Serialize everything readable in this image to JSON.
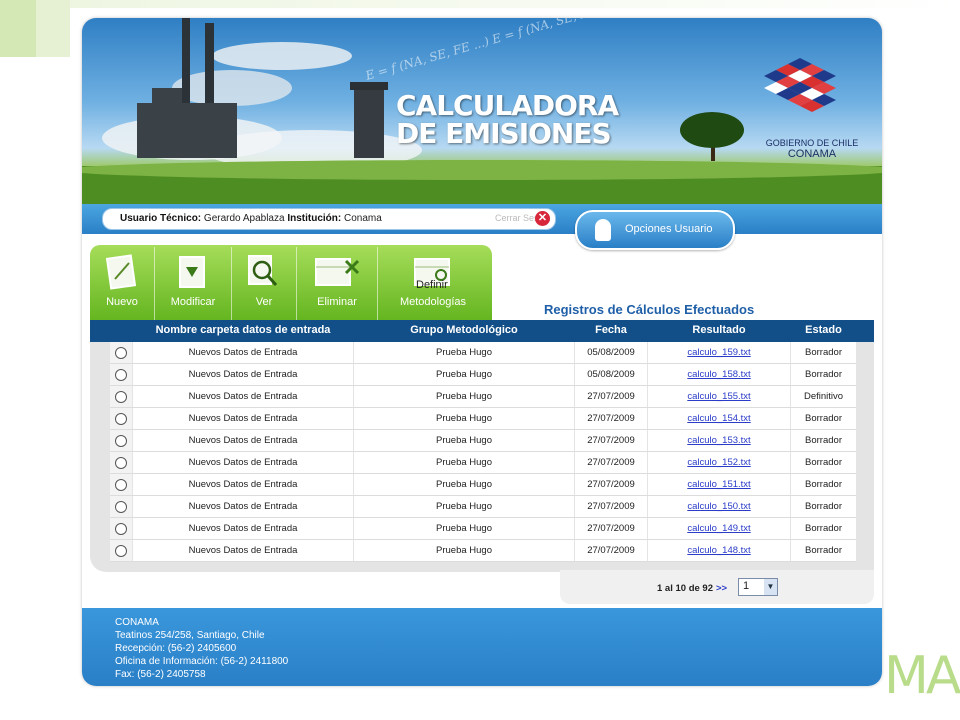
{
  "banner": {
    "title_line1": "CALCULADORA",
    "title_line2": "DE EMISIONES",
    "formula": "E = f (NA, SE, FE ...) E = f (NA, SE, FE ...)",
    "gov_line1": "GOBIERNO DE CHILE",
    "gov_line2": "CONAMA"
  },
  "userbar": {
    "user_label": "Usuario Técnico:",
    "user_value": "Gerardo Apablaza",
    "institution_label": "Institución:",
    "institution_value": "Conama",
    "logout_label": "Cerrar Sesión",
    "options_label": "Opciones Usuario"
  },
  "toolbar": {
    "items": [
      {
        "label": "Nuevo"
      },
      {
        "label": "Modificar"
      },
      {
        "label": "Ver"
      },
      {
        "label": "Eliminar"
      },
      {
        "label": "Metodologías"
      }
    ],
    "overlay_text": "Definir"
  },
  "records": {
    "title": "Registros de Cálculos Efectuados",
    "columns": [
      "Nombre carpeta datos de entrada",
      "Grupo Metodológico",
      "Fecha",
      "Resultado",
      "Estado"
    ],
    "rows": [
      {
        "name": "Nuevos Datos de Entrada",
        "group": "Prueba Hugo",
        "date": "05/08/2009",
        "result": "calculo_159.txt",
        "status": "Borrador"
      },
      {
        "name": "Nuevos Datos de Entrada",
        "group": "Prueba Hugo",
        "date": "05/08/2009",
        "result": "calculo_158.txt",
        "status": "Borrador"
      },
      {
        "name": "Nuevos Datos de Entrada",
        "group": "Prueba Hugo",
        "date": "27/07/2009",
        "result": "calculo_155.txt",
        "status": "Definitivo"
      },
      {
        "name": "Nuevos Datos de Entrada",
        "group": "Prueba Hugo",
        "date": "27/07/2009",
        "result": "calculo_154.txt",
        "status": "Borrador"
      },
      {
        "name": "Nuevos Datos de Entrada",
        "group": "Prueba Hugo",
        "date": "27/07/2009",
        "result": "calculo_153.txt",
        "status": "Borrador"
      },
      {
        "name": "Nuevos Datos de Entrada",
        "group": "Prueba Hugo",
        "date": "27/07/2009",
        "result": "calculo_152.txt",
        "status": "Borrador"
      },
      {
        "name": "Nuevos Datos de Entrada",
        "group": "Prueba Hugo",
        "date": "27/07/2009",
        "result": "calculo_151.txt",
        "status": "Borrador"
      },
      {
        "name": "Nuevos Datos de Entrada",
        "group": "Prueba Hugo",
        "date": "27/07/2009",
        "result": "calculo_150.txt",
        "status": "Borrador"
      },
      {
        "name": "Nuevos Datos de Entrada",
        "group": "Prueba Hugo",
        "date": "27/07/2009",
        "result": "calculo_149.txt",
        "status": "Borrador"
      },
      {
        "name": "Nuevos Datos de Entrada",
        "group": "Prueba Hugo",
        "date": "27/07/2009",
        "result": "calculo_148.txt",
        "status": "Borrador"
      }
    ]
  },
  "pager": {
    "summary": "1 al 10 de 92",
    "next": ">>",
    "selected_page": "1"
  },
  "footer": {
    "lines": [
      "CONAMA",
      "Teatinos 254/258, Santiago, Chile",
      "Recepción: (56-2) 2405600",
      "Oficina de Información: (56-2) 2411800",
      "Fax: (56-2) 2405758"
    ]
  },
  "decor": {
    "side_letters": "MA"
  },
  "colors": {
    "primary_blue": "#2a7fc6",
    "header_navy": "#124f88",
    "toolbar_green": "#62b41e",
    "link_blue": "#2a3cc8",
    "title_blue": "#1f5fa8"
  }
}
